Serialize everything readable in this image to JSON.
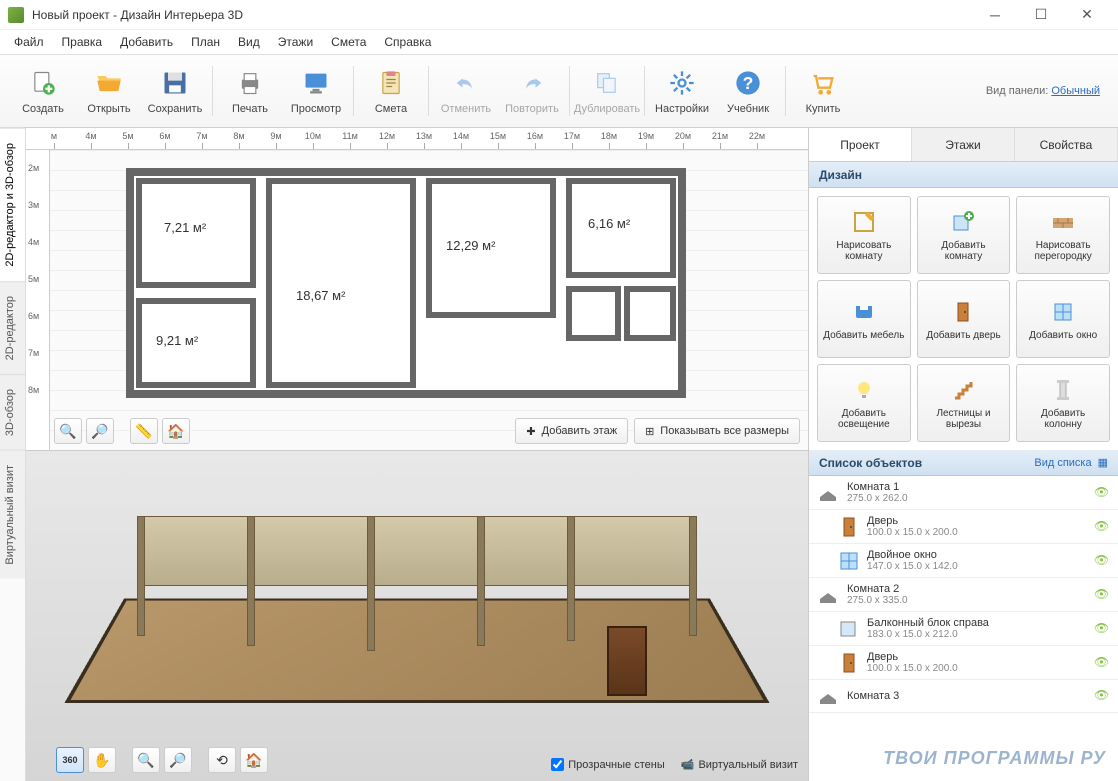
{
  "window": {
    "title": "Новый проект - Дизайн Интерьера 3D"
  },
  "menu": [
    "Файл",
    "Правка",
    "Добавить",
    "План",
    "Вид",
    "Этажи",
    "Смета",
    "Справка"
  ],
  "toolbar": {
    "items": [
      {
        "label": "Создать",
        "icon": "file-new"
      },
      {
        "label": "Открыть",
        "icon": "folder-open"
      },
      {
        "label": "Сохранить",
        "icon": "save"
      },
      {
        "sep": true
      },
      {
        "label": "Печать",
        "icon": "printer"
      },
      {
        "label": "Просмотр",
        "icon": "monitor"
      },
      {
        "sep": true
      },
      {
        "label": "Смета",
        "icon": "clipboard"
      },
      {
        "sep": true
      },
      {
        "label": "Отменить",
        "icon": "undo",
        "disabled": true
      },
      {
        "label": "Повторить",
        "icon": "redo",
        "disabled": true
      },
      {
        "sep": true
      },
      {
        "label": "Дублировать",
        "icon": "duplicate",
        "disabled": true
      },
      {
        "sep": true
      },
      {
        "label": "Настройки",
        "icon": "gear"
      },
      {
        "label": "Учебник",
        "icon": "help"
      },
      {
        "sep": true
      },
      {
        "label": "Купить",
        "icon": "cart"
      }
    ],
    "panel_label": "Вид панели:",
    "panel_mode": "Обычный"
  },
  "left_tabs": [
    "2D-редактор и 3D-обзор",
    "2D-редактор",
    "3D-обзор",
    "Виртуальный визит"
  ],
  "ruler_x": [
    "м",
    "4м",
    "5м",
    "6м",
    "7м",
    "8м",
    "9м",
    "10м",
    "11м",
    "12м",
    "13м",
    "14м",
    "15м",
    "16м",
    "17м",
    "18м",
    "19м",
    "20м",
    "21м",
    "22м"
  ],
  "ruler_y": [
    "2м",
    "3м",
    "4м",
    "5м",
    "6м",
    "7м",
    "8м"
  ],
  "rooms": [
    {
      "label": "7,21 м²"
    },
    {
      "label": "18,67 м²"
    },
    {
      "label": "12,29 м²"
    },
    {
      "label": "6,16 м²"
    },
    {
      "label": "9,21 м²"
    }
  ],
  "plan_actions": {
    "add_floor": "Добавить этаж",
    "show_dims": "Показывать все размеры"
  },
  "view3d_controls": {
    "transparent_walls": "Прозрачные стены",
    "record": "Виртуальный визит"
  },
  "right_tabs": [
    "Проект",
    "Этажи",
    "Свойства"
  ],
  "design_hdr": "Дизайн",
  "design_tools": [
    {
      "label": "Нарисовать комнату",
      "icon": "draw-room"
    },
    {
      "label": "Добавить комнату",
      "icon": "add-room"
    },
    {
      "label": "Нарисовать перегородку",
      "icon": "wall"
    },
    {
      "label": "Добавить мебель",
      "icon": "furniture"
    },
    {
      "label": "Добавить дверь",
      "icon": "door"
    },
    {
      "label": "Добавить окно",
      "icon": "window"
    },
    {
      "label": "Добавить освещение",
      "icon": "light"
    },
    {
      "label": "Лестницы и вырезы",
      "icon": "stairs"
    },
    {
      "label": "Добавить колонну",
      "icon": "column"
    }
  ],
  "objects_hdr": "Список объектов",
  "objects_hdr_right": "Вид списка",
  "objects": [
    {
      "name": "Комната 1",
      "dim": "275.0 x 262.0",
      "icon": "room",
      "level": 0
    },
    {
      "name": "Дверь",
      "dim": "100.0 x 15.0 x 200.0",
      "icon": "door",
      "level": 1
    },
    {
      "name": "Двойное окно",
      "dim": "147.0 x 15.0 x 142.0",
      "icon": "window",
      "level": 1
    },
    {
      "name": "Комната 2",
      "dim": "275.0 x 335.0",
      "icon": "room",
      "level": 0
    },
    {
      "name": "Балконный блок справа",
      "dim": "183.0 x 15.0 x 212.0",
      "icon": "balcony",
      "level": 1
    },
    {
      "name": "Дверь",
      "dim": "100.0 x 15.0 x 200.0",
      "icon": "door",
      "level": 1
    },
    {
      "name": "Комната 3",
      "dim": "",
      "icon": "room",
      "level": 0
    }
  ],
  "watermark": "ТВОИ ПРОГРАММЫ РУ"
}
